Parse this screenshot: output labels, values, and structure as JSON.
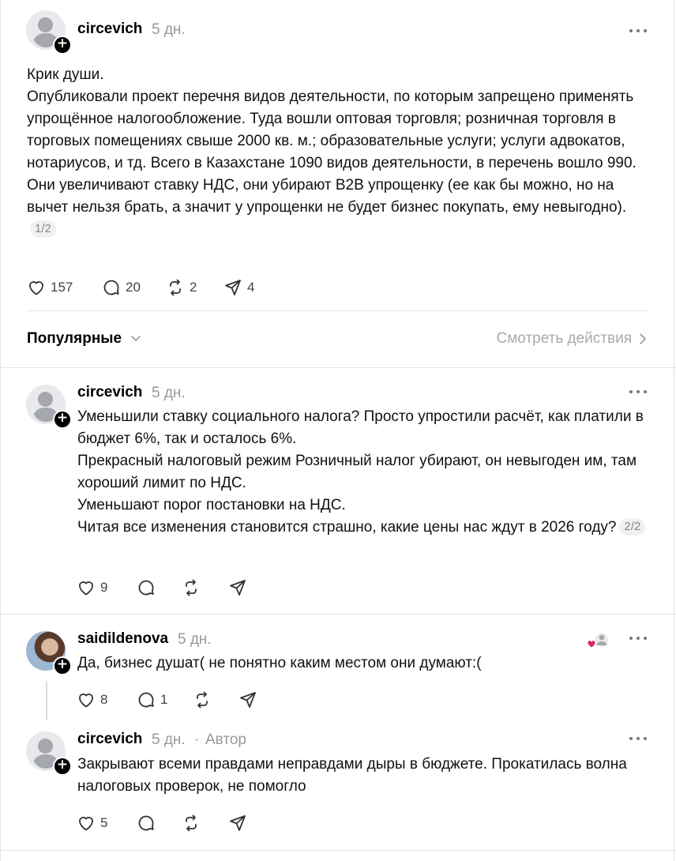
{
  "post": {
    "author": "circevich",
    "time": "5 дн.",
    "text": "Крик души.\nОпубликовали проект перечня видов деятельности, по которым запрещено применять упрощённое налогообложение. Туда вошли оптовая торговля; розничная торговля в торговых помещениях свыше 2000 кв. м.; образовательные услуги; услуги адвокатов, нотариусов, и тд. Всего в Казахстане 1090 видов деятельности, в перечень вошло 990.\nОни увеличивают ставку НДС, они убирают B2B упрощенку (ее как бы можно, но на вычет нельзя брать, а значит у упрощенки не будет бизнес покупать, ему невыгодно).",
    "pager": "1/2",
    "likes": "157",
    "replies": "20",
    "reposts": "2",
    "shares": "4"
  },
  "sort": {
    "label": "Популярные",
    "view_actions": "Смотреть действия"
  },
  "reply1": {
    "author": "circevich",
    "time": "5 дн.",
    "text": "Уменьшили ставку социального налога? Просто упростили расчёт, как платили в бюджет 6%, так и осталось 6%.\nПрекрасный налоговый режим Розничный налог убирают, он невыгоден им, там хороший лимит по НДС.\nУменьшают порог постановки на НДС.\nЧитая все изменения становится страшно, какие цены нас ждут в 2026 году?",
    "pager": "2/2",
    "likes": "9"
  },
  "reply2": {
    "author": "saidildenova",
    "time": "5 дн.",
    "text": "Да, бизнес душат( не понятно каким местом они думают:(",
    "likes": "8",
    "replies": "1"
  },
  "reply3": {
    "author": "circevich",
    "time": "5 дн.",
    "separator": "·",
    "author_badge": "Автор",
    "text": "Закрывают всеми правдами неправдами дыры в бюджете. Прокатилась волна налоговых проверок, не помогло",
    "likes": "5"
  },
  "icons": [
    "more-icon",
    "heart-icon",
    "comment-icon",
    "repost-icon",
    "share-icon",
    "chevron-down-icon",
    "chevron-right-icon",
    "follow-plus-icon"
  ],
  "colors": {
    "text": "#111111",
    "muted": "#999999",
    "divider": "#e3e3e3",
    "like_red": "#e0245e"
  }
}
